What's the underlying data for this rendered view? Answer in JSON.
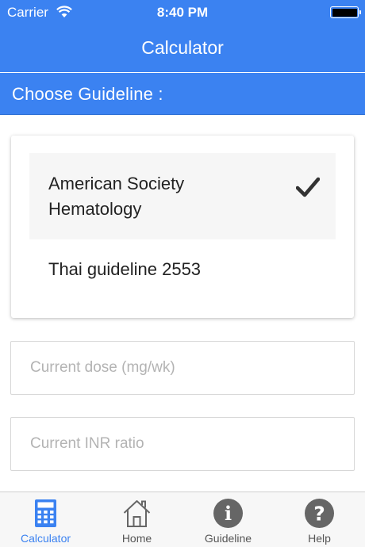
{
  "status_bar": {
    "carrier": "Carrier",
    "time": "8:40 PM"
  },
  "nav": {
    "title": "Calculator"
  },
  "section": {
    "title": "Choose Guideline :"
  },
  "guidelines": [
    {
      "label": "American Society Hematology",
      "selected": true
    },
    {
      "label": "Thai guideline 2553",
      "selected": false
    }
  ],
  "form": {
    "dose_placeholder": "Current dose (mg/wk)",
    "inr_placeholder": "Current INR ratio"
  },
  "tabs": [
    {
      "label": "Calculator",
      "icon": "calculator-icon",
      "active": true
    },
    {
      "label": "Home",
      "icon": "home-icon",
      "active": false
    },
    {
      "label": "Guideline",
      "icon": "info-icon",
      "active": false
    },
    {
      "label": "Help",
      "icon": "question-icon",
      "active": false
    }
  ],
  "colors": {
    "accent": "#3b82f1",
    "inactive_icon": "#666666"
  }
}
